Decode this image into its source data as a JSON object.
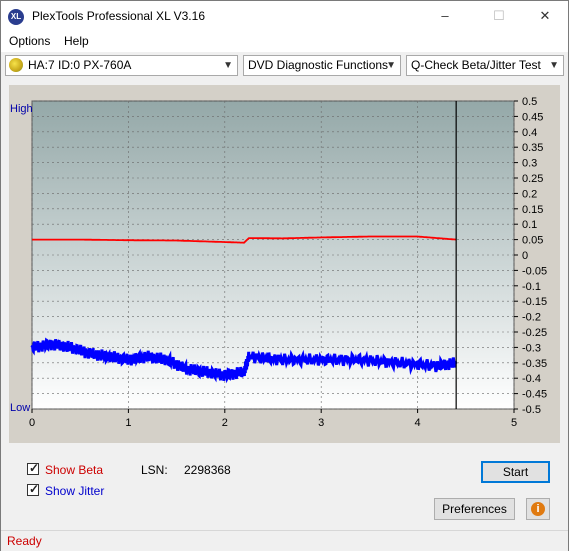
{
  "window": {
    "title": "PlexTools Professional XL V3.16",
    "icon_text": "XL"
  },
  "menu": {
    "items": [
      "Options",
      "Help"
    ]
  },
  "toolbar": {
    "drive": "HA:7 ID:0  PX-760A",
    "category": "DVD Diagnostic Functions",
    "test": "Q-Check Beta/Jitter Test"
  },
  "chart_data": {
    "type": "line",
    "xlabel": "",
    "ylabel": "",
    "x_ticks": [
      "0",
      "1",
      "2",
      "3",
      "4",
      "5"
    ],
    "xlim": [
      0,
      5
    ],
    "y_left_labels": {
      "top": "High",
      "bottom": "Low"
    },
    "y_right_ticks": [
      "0.5",
      "0.45",
      "0.4",
      "0.35",
      "0.3",
      "0.25",
      "0.2",
      "0.15",
      "0.1",
      "0.05",
      "0",
      "-0.05",
      "-0.1",
      "-0.15",
      "-0.2",
      "-0.25",
      "-0.3",
      "-0.35",
      "-0.4",
      "-0.45",
      "-0.5"
    ],
    "ylim": [
      -0.5,
      0.5
    ],
    "grid": true,
    "end_marker_x": 4.4,
    "series": [
      {
        "color": "#ff0000",
        "x": [
          0,
          0.5,
          1.0,
          1.5,
          2.0,
          2.2,
          2.25,
          2.6,
          3.0,
          3.5,
          4.0,
          4.4
        ],
        "y": [
          0.05,
          0.05,
          0.048,
          0.047,
          0.042,
          0.04,
          0.055,
          0.054,
          0.057,
          0.06,
          0.06,
          0.05
        ]
      },
      {
        "color": "#0000ff",
        "x": [
          0,
          0.2,
          0.4,
          0.6,
          0.8,
          1.0,
          1.2,
          1.4,
          1.6,
          1.8,
          2.0,
          2.2,
          2.25,
          2.6,
          3.0,
          3.4,
          3.8,
          4.2,
          4.4
        ],
        "y": [
          -0.3,
          -0.29,
          -0.3,
          -0.32,
          -0.33,
          -0.34,
          -0.33,
          -0.34,
          -0.37,
          -0.38,
          -0.39,
          -0.38,
          -0.33,
          -0.34,
          -0.34,
          -0.34,
          -0.35,
          -0.36,
          -0.35
        ]
      }
    ]
  },
  "controls": {
    "show_beta": "Show Beta",
    "show_jitter": "Show Jitter",
    "lsn_label": "LSN:",
    "lsn_value": "2298368",
    "start": "Start",
    "preferences": "Preferences"
  },
  "status": {
    "text": "Ready"
  },
  "colors": {
    "beta": "#cc0000",
    "jitter": "#0000cc",
    "status": "#cc0000"
  }
}
